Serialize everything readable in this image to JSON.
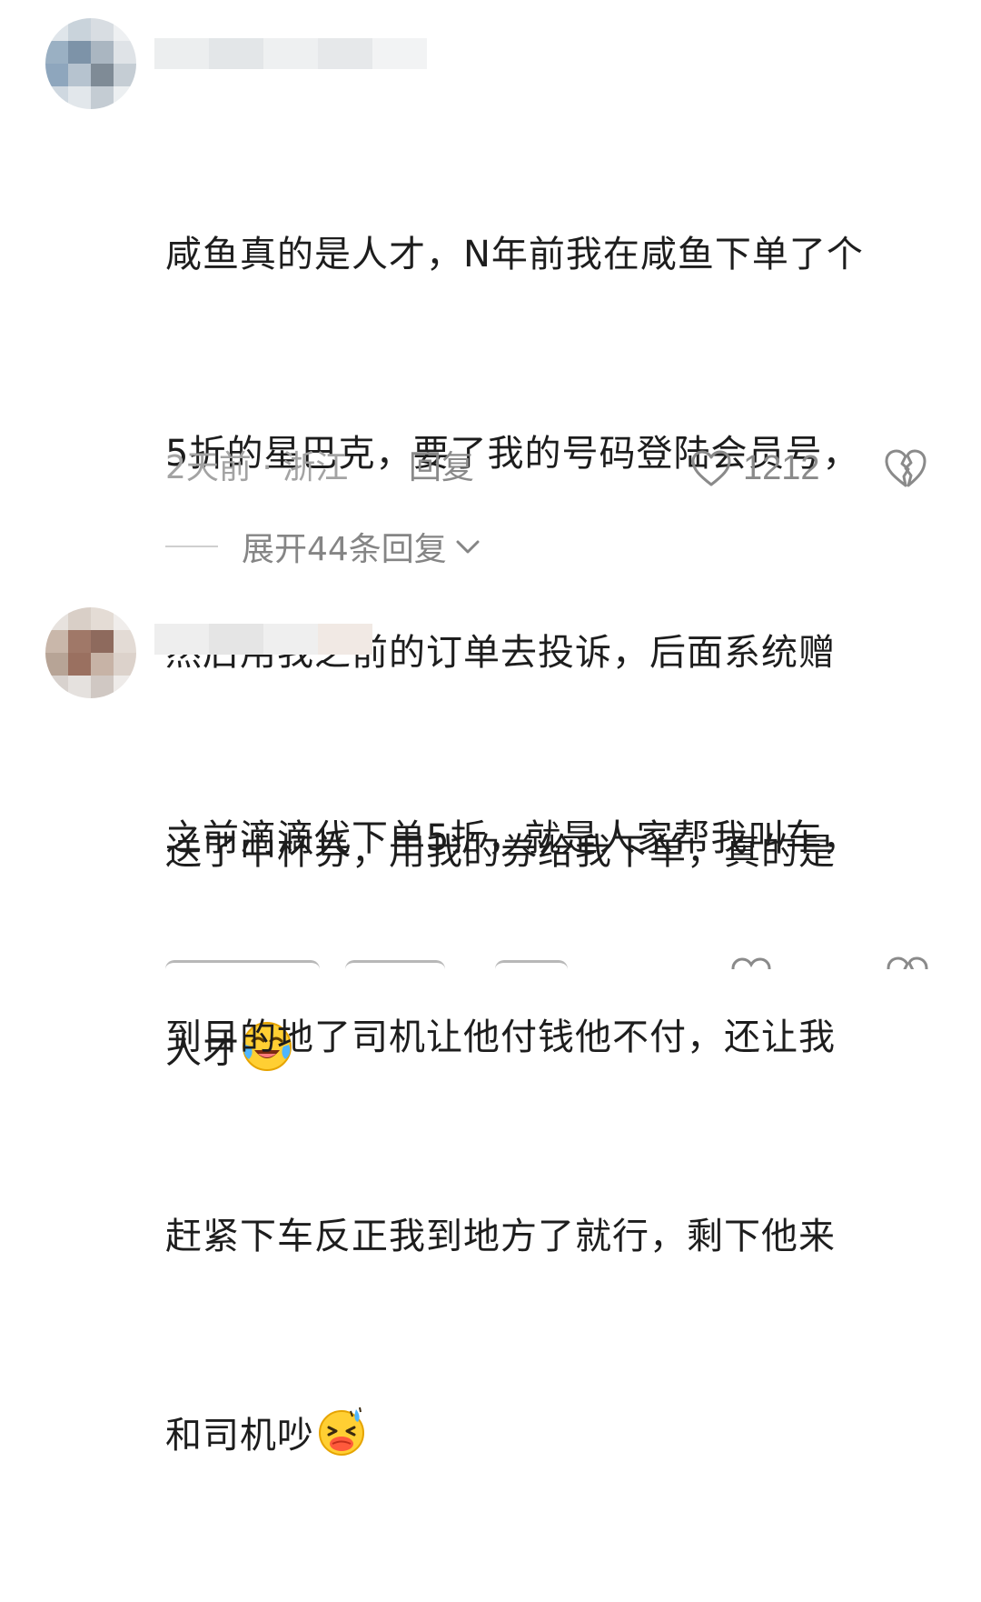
{
  "comments": [
    {
      "text_lines": [
        "咸鱼真的是人才，N年前我在咸鱼下单了个",
        "5折的星巴克，要了我的号码登陆会员号，",
        "然后用我之前的订单去投诉，后面系统赠",
        "送了中杯券，用我的券给我下单，真的是",
        "人才"
      ],
      "emoji": "laughing-crying-emoji",
      "meta": "2天前 · 浙江",
      "reply_label": "回复",
      "like_count": "1212",
      "expand_label": "展开44条回复"
    },
    {
      "text_lines": [
        "之前滴滴代下单5折，就是人家帮我叫车，",
        "到目的地了司机让他付钱他不付，还让我",
        "赶紧下车反正我到地方了就行，剩下他来",
        "和司机吵"
      ],
      "emoji": "sweating-smile-emoji",
      "meta": "",
      "reply_label": "",
      "like_count": ""
    }
  ],
  "colors": {
    "text": "#1d1d1d",
    "meta": "#a3a3a3",
    "icon": "#8a8a8a",
    "divider": "#cfcfcf"
  }
}
